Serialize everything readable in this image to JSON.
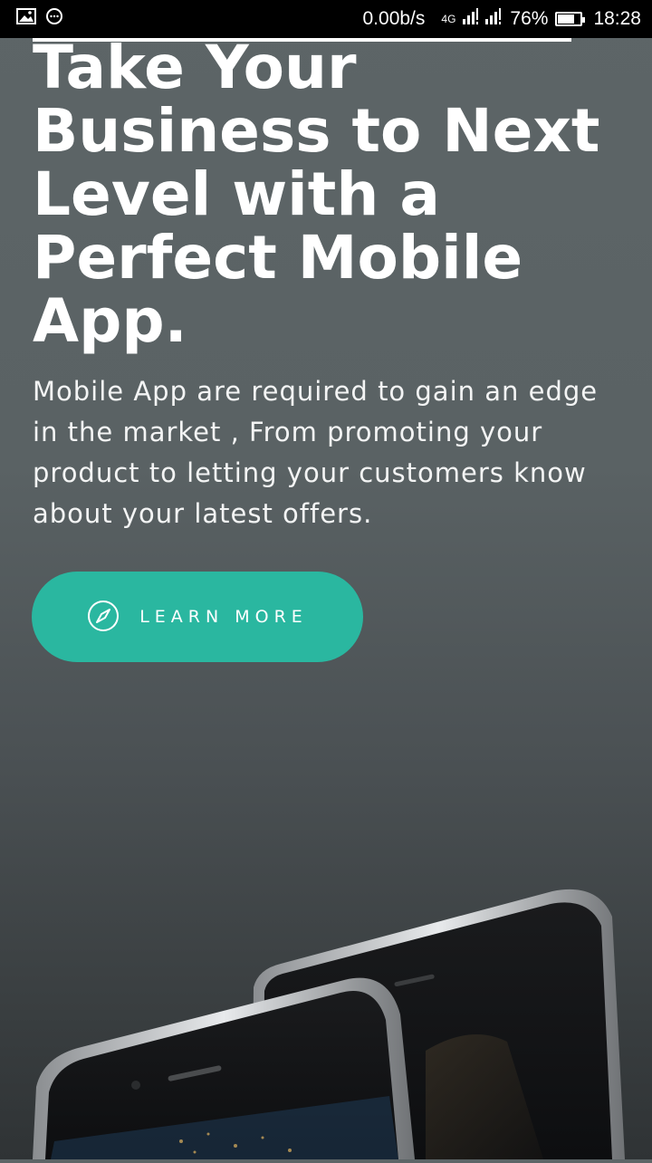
{
  "status_bar": {
    "speed": "0.00b/s",
    "network": "4G",
    "battery_percent": "76%",
    "battery_level": 0.76,
    "time": "18:28",
    "icons": [
      "gallery-icon",
      "messenger-icon",
      "signal-icon",
      "battery-icon"
    ]
  },
  "hero": {
    "title_lines": [
      "Take Your",
      "Business to Next",
      "Level with a",
      "Perfect Mobile",
      "App."
    ],
    "description": "Mobile App are required to gain an edge in the market , From promoting your product to letting your customers know about your latest offers.",
    "cta_label": "LEARN MORE",
    "cta_icon": "compass-icon"
  },
  "colors": {
    "accent": "#2ab7a0",
    "background_top": "#5d6567",
    "background_bottom": "#2f3335"
  }
}
